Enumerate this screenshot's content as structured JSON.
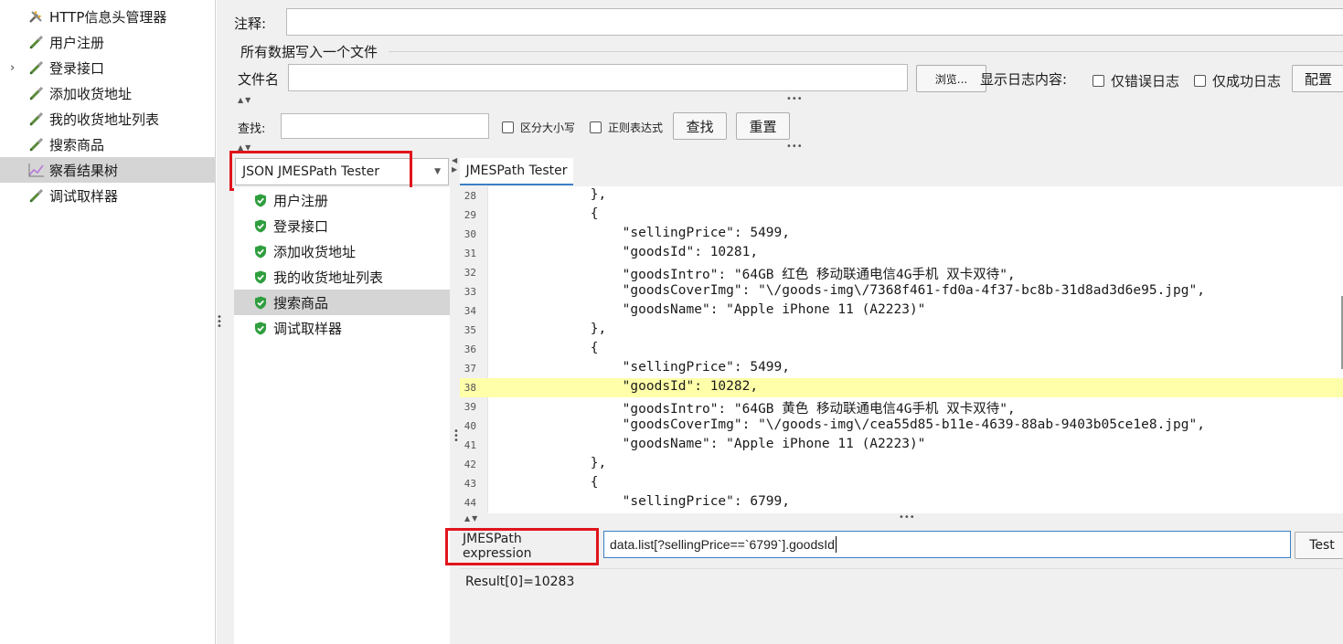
{
  "tree": {
    "items": [
      {
        "label": "HTTP信息头管理器",
        "icon": "wrench-icon",
        "arrow": ""
      },
      {
        "label": "用户注册",
        "icon": "pipette-icon",
        "arrow": ""
      },
      {
        "label": "登录接口",
        "icon": "pipette-icon",
        "arrow": "›"
      },
      {
        "label": "添加收货地址",
        "icon": "pipette-icon",
        "arrow": ""
      },
      {
        "label": " 我的收货地址列表",
        "icon": "pipette-icon",
        "arrow": ""
      },
      {
        "label": "搜索商品",
        "icon": "pipette-icon",
        "arrow": ""
      },
      {
        "label": "察看结果树",
        "icon": "chart-icon",
        "arrow": ""
      },
      {
        "label": "调试取样器",
        "icon": "pipette-icon",
        "arrow": ""
      }
    ],
    "selected_index": 6
  },
  "form": {
    "comment_label": "注释:",
    "write_all_label": "所有数据写入一个文件",
    "filename_label": "文件名",
    "browse_label": "浏览...",
    "log_label": "显示日志内容:",
    "errors_only_label": "仅错误日志",
    "success_only_label": "仅成功日志",
    "config_label": "配置"
  },
  "search": {
    "label": "查找:",
    "case_label": "区分大小写",
    "regex_label": "正则表达式",
    "find_label": "查找",
    "reset_label": "重置"
  },
  "renderer": {
    "selected": "JSON JMESPath Tester"
  },
  "samplers": [
    {
      "label": "用户注册"
    },
    {
      "label": "登录接口"
    },
    {
      "label": "添加收货地址"
    },
    {
      "label": " 我的收货地址列表"
    },
    {
      "label": "搜索商品"
    },
    {
      "label": "调试取样器"
    }
  ],
  "selected_sampler": 4,
  "tab_label": "JMESPath Tester",
  "code": {
    "highlight_line": 38,
    "lines": [
      {
        "n": "28",
        "t": "            },"
      },
      {
        "n": "29",
        "t": "            {"
      },
      {
        "n": "30",
        "t": "                \"sellingPrice\": 5499,"
      },
      {
        "n": "31",
        "t": "                \"goodsId\": 10281,"
      },
      {
        "n": "32",
        "t": "                \"goodsIntro\": \"64GB 红色 移动联通电信4G手机 双卡双待\","
      },
      {
        "n": "33",
        "t": "                \"goodsCoverImg\": \"\\/goods-img\\/7368f461-fd0a-4f37-bc8b-31d8ad3d6e95.jpg\","
      },
      {
        "n": "34",
        "t": "                \"goodsName\": \"Apple iPhone 11 (A2223)\""
      },
      {
        "n": "35",
        "t": "            },"
      },
      {
        "n": "36",
        "t": "            {"
      },
      {
        "n": "37",
        "t": "                \"sellingPrice\": 5499,"
      },
      {
        "n": "38",
        "t": "                \"goodsId\": 10282,"
      },
      {
        "n": "39",
        "t": "                \"goodsIntro\": \"64GB 黄色 移动联通电信4G手机 双卡双待\","
      },
      {
        "n": "40",
        "t": "                \"goodsCoverImg\": \"\\/goods-img\\/cea55d85-b11e-4639-88ab-9403b05ce1e8.jpg\","
      },
      {
        "n": "41",
        "t": "                \"goodsName\": \"Apple iPhone 11 (A2223)\""
      },
      {
        "n": "42",
        "t": "            },"
      },
      {
        "n": "43",
        "t": "            {"
      },
      {
        "n": "44",
        "t": "                \"sellingPrice\": 6799,"
      }
    ]
  },
  "expression": {
    "label": "JMESPath expression",
    "value": "data.list[?sellingPrice==`6799`].goodsId",
    "test_label": "Test"
  },
  "result": {
    "text": "Result[0]=10283"
  },
  "colors": {
    "highlight": "#ffffaa",
    "redbox": "#e0141c",
    "selection": "#d5d5d5",
    "accent": "#3c7fc4"
  }
}
